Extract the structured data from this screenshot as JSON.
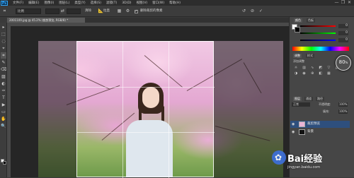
{
  "app": {
    "logo_text": "Ps"
  },
  "menu": {
    "items": [
      "文件(F)",
      "编辑(E)",
      "图像(I)",
      "图层(L)",
      "类型(Y)",
      "选择(S)",
      "滤镜(T)",
      "3D(D)",
      "视图(V)",
      "窗口(W)",
      "帮助(H)"
    ]
  },
  "window_controls": {
    "minimize": "—",
    "restore": "❐",
    "close": "✕"
  },
  "options_bar": {
    "preset_value": "比例",
    "ratio_w": "",
    "ratio_h": "",
    "clear_label": "清除",
    "straighten_label": "拉直",
    "delete_cropped_label": "删除裁剪的像素",
    "delete_cropped_checked": true,
    "reset_icon": "reset-icon",
    "cancel_icon": "cancel-icon",
    "commit_icon": "commit-icon"
  },
  "document": {
    "tab_title": "2001109.jpg @ 45.2% (裁剪预览, RGB/8) *"
  },
  "tools": [
    "▸",
    "⬚",
    "◌",
    "⌖",
    "⌗",
    "✎",
    "⌫",
    "▨",
    "◐",
    "✑",
    "T",
    "▶",
    "▭",
    "✋",
    "🔍"
  ],
  "colors": {
    "foreground": "#ffffff",
    "background": "#000000",
    "accent": "#2e4f7d"
  },
  "panels": {
    "color_tab": "颜色",
    "swatches_tab": "色板",
    "adjust_tab": "调整",
    "styles_tab": "样式",
    "add_adjust_label": "添加调整",
    "layers_tab": "图层",
    "channels_tab": "通道",
    "paths_tab": "路径",
    "blend_mode": "正常",
    "opacity_label": "不透明度:",
    "opacity_value": "100%",
    "fill_label": "填充:",
    "fill_value": "100%",
    "slider_values": [
      "0",
      "0",
      "0"
    ]
  },
  "layers": [
    {
      "name": "裁剪预览",
      "selected": true
    },
    {
      "name": "背景",
      "selected": false
    }
  ],
  "zoom_badge": {
    "value": "80",
    "unit": "%"
  },
  "watermark": {
    "text": "Bai经验",
    "url": "jingyan.baidu.com"
  }
}
